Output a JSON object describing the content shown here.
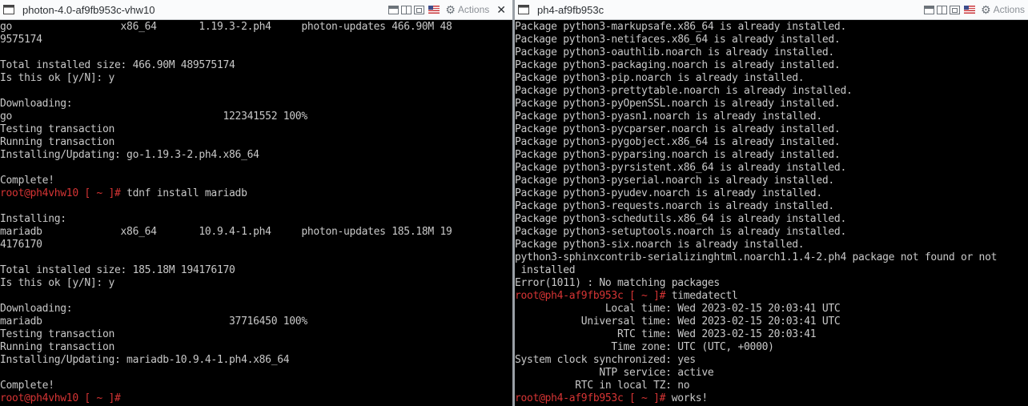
{
  "left": {
    "title": "photon-4.0-af9fb953c-vhw10",
    "actions_label": "Actions",
    "lines": [
      {
        "text": "go                  x86_64       1.19.3-2.ph4     photon-updates 466.90M 48"
      },
      {
        "text": "9575174"
      },
      {
        "text": ""
      },
      {
        "text": "Total installed size: 466.90M 489575174"
      },
      {
        "text": "Is this ok [y/N]: y"
      },
      {
        "text": ""
      },
      {
        "text": "Downloading:"
      },
      {
        "text": "go                                   122341552 100%"
      },
      {
        "text": "Testing transaction"
      },
      {
        "text": "Running transaction"
      },
      {
        "text": "Installing/Updating: go-1.19.3-2.ph4.x86_64"
      },
      {
        "text": ""
      },
      {
        "text": "Complete!"
      },
      {
        "prompt": "root@ph4vhw10 [ ~ ]# ",
        "text": "tdnf install mariadb"
      },
      {
        "text": ""
      },
      {
        "text": "Installing:"
      },
      {
        "text": "mariadb             x86_64       10.9.4-1.ph4     photon-updates 185.18M 19"
      },
      {
        "text": "4176170"
      },
      {
        "text": ""
      },
      {
        "text": "Total installed size: 185.18M 194176170"
      },
      {
        "text": "Is this ok [y/N]: y"
      },
      {
        "text": ""
      },
      {
        "text": "Downloading:"
      },
      {
        "text": "mariadb                               37716450 100%"
      },
      {
        "text": "Testing transaction"
      },
      {
        "text": "Running transaction"
      },
      {
        "text": "Installing/Updating: mariadb-10.9.4-1.ph4.x86_64"
      },
      {
        "text": ""
      },
      {
        "text": "Complete!"
      },
      {
        "prompt": "root@ph4vhw10 [ ~ ]# ",
        "text": ""
      }
    ]
  },
  "right": {
    "title": "ph4-af9fb953c",
    "actions_label": "Actions",
    "lines": [
      {
        "text": "Package python3-markupsafe.x86_64 is already installed."
      },
      {
        "text": "Package python3-netifaces.x86_64 is already installed."
      },
      {
        "text": "Package python3-oauthlib.noarch is already installed."
      },
      {
        "text": "Package python3-packaging.noarch is already installed."
      },
      {
        "text": "Package python3-pip.noarch is already installed."
      },
      {
        "text": "Package python3-prettytable.noarch is already installed."
      },
      {
        "text": "Package python3-pyOpenSSL.noarch is already installed."
      },
      {
        "text": "Package python3-pyasn1.noarch is already installed."
      },
      {
        "text": "Package python3-pycparser.noarch is already installed."
      },
      {
        "text": "Package python3-pygobject.x86_64 is already installed."
      },
      {
        "text": "Package python3-pyparsing.noarch is already installed."
      },
      {
        "text": "Package python3-pyrsistent.x86_64 is already installed."
      },
      {
        "text": "Package python3-pyserial.noarch is already installed."
      },
      {
        "text": "Package python3-pyudev.noarch is already installed."
      },
      {
        "text": "Package python3-requests.noarch is already installed."
      },
      {
        "text": "Package python3-schedutils.x86_64 is already installed."
      },
      {
        "text": "Package python3-setuptools.noarch is already installed."
      },
      {
        "text": "Package python3-six.noarch is already installed."
      },
      {
        "text": "python3-sphinxcontrib-serializinghtml.noarch1.1.4-2.ph4 package not found or not"
      },
      {
        "text": " installed"
      },
      {
        "text": "Error(1011) : No matching packages"
      },
      {
        "prompt": "root@ph4-af9fb953c [ ~ ]# ",
        "text": "timedatectl"
      },
      {
        "text": "               Local time: Wed 2023-02-15 20:03:41 UTC"
      },
      {
        "text": "           Universal time: Wed 2023-02-15 20:03:41 UTC"
      },
      {
        "text": "                 RTC time: Wed 2023-02-15 20:03:41"
      },
      {
        "text": "                Time zone: UTC (UTC, +0000)"
      },
      {
        "text": "System clock synchronized: yes"
      },
      {
        "text": "              NTP service: active"
      },
      {
        "text": "          RTC in local TZ: no"
      },
      {
        "prompt": "root@ph4-af9fb953c [ ~ ]# ",
        "text": "works!"
      }
    ]
  }
}
